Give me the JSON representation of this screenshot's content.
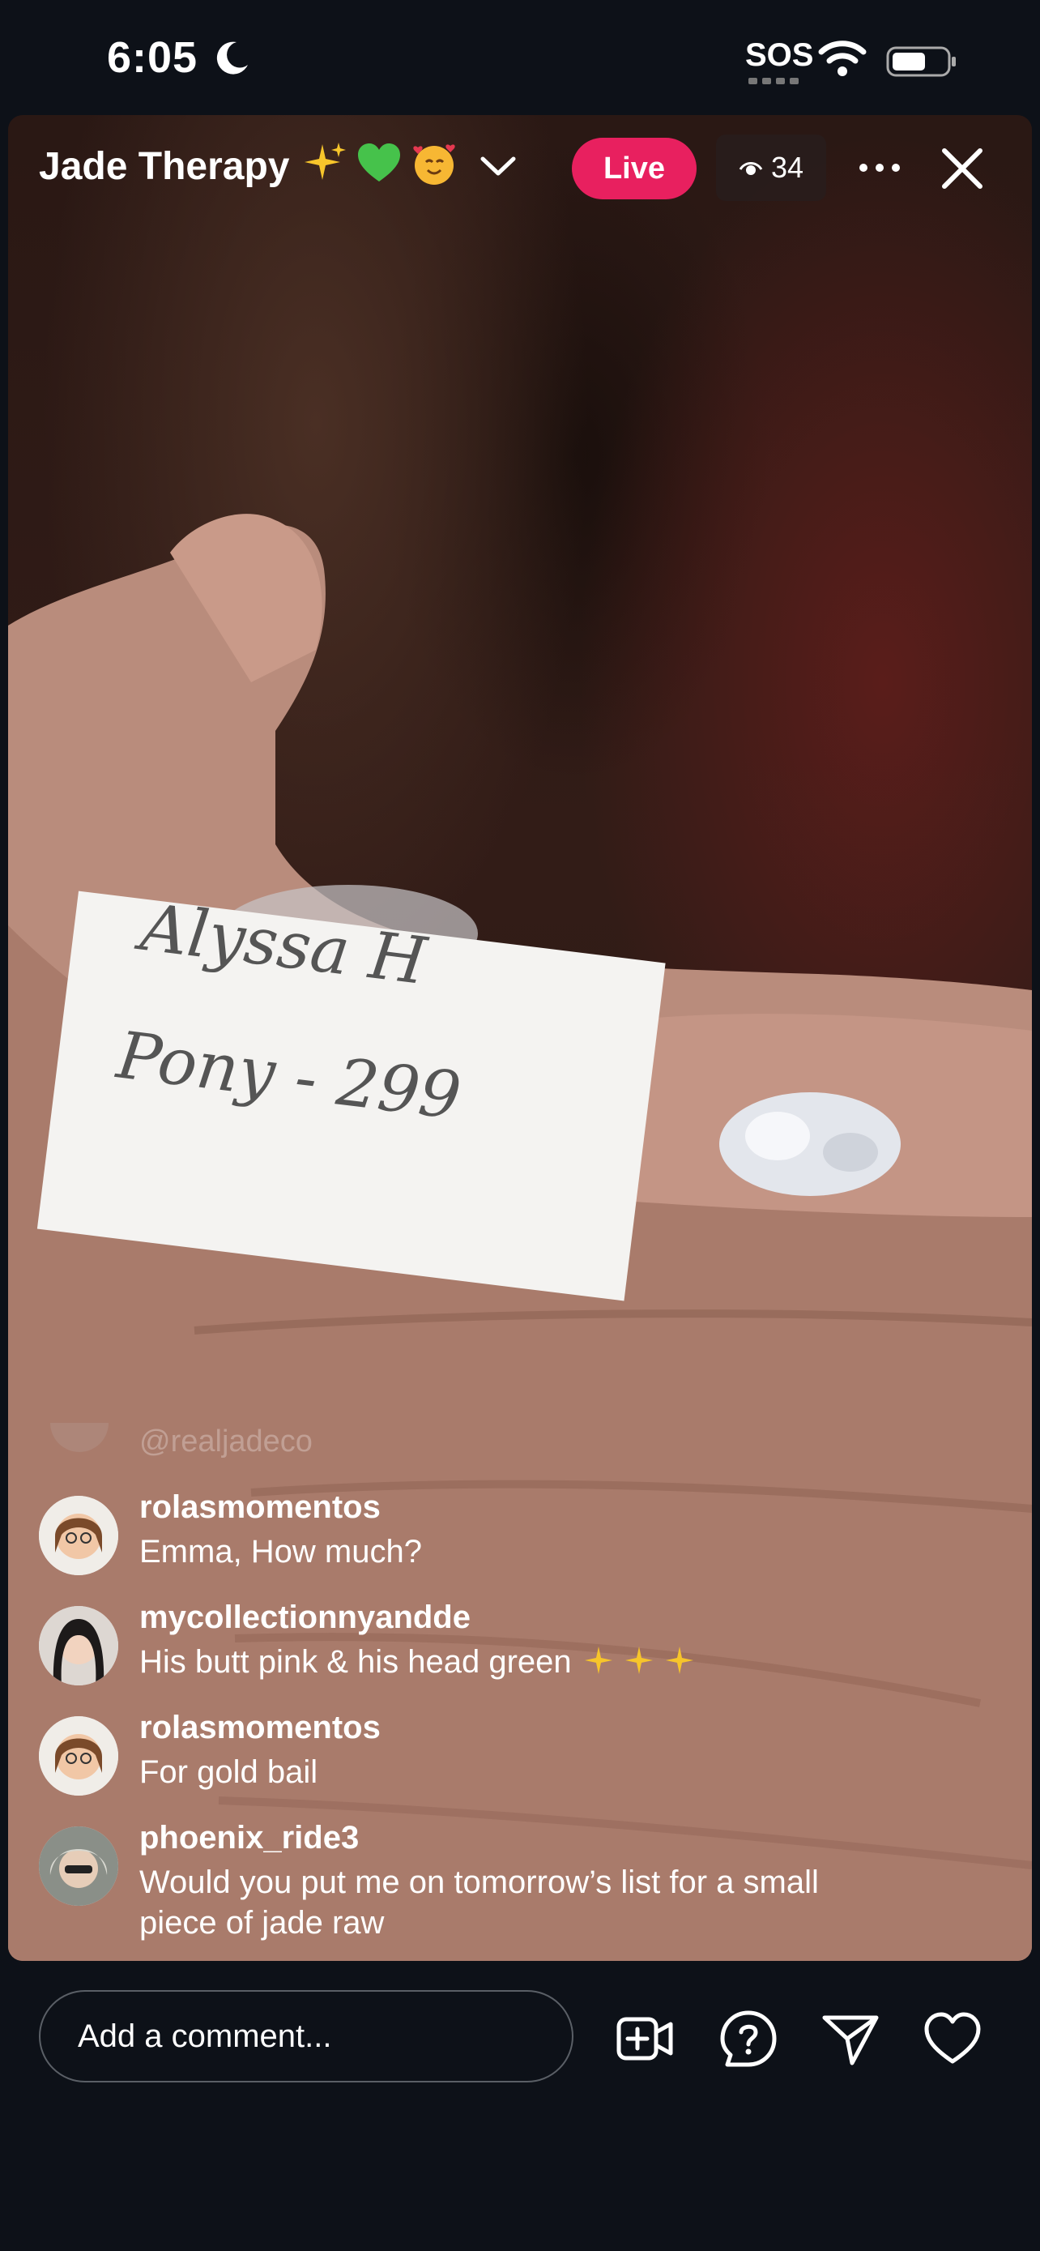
{
  "status_bar": {
    "time": "6:05",
    "sos": "SOS"
  },
  "header": {
    "title": "Jade Therapy",
    "live_label": "Live",
    "viewer_count": "34"
  },
  "video": {
    "card_line1": "Alyssa H",
    "card_line2": "Pony - 299"
  },
  "comments": {
    "faded": "@realjadeco",
    "items": [
      {
        "user": "rolasmomentos",
        "text": "Emma, How much?"
      },
      {
        "user": "mycollectionnyandde",
        "text": "His butt pink & his head green"
      },
      {
        "user": "rolasmomentos",
        "text": "For gold bail"
      },
      {
        "user": "phoenix_ride3",
        "text": "Would you put me on tomorrow’s list for a small",
        "text2": "piece of jade raw"
      }
    ]
  },
  "bottom_bar": {
    "comment_placeholder": "Add a comment..."
  },
  "colors": {
    "live": "#e8205f",
    "background": "#0d1118"
  }
}
